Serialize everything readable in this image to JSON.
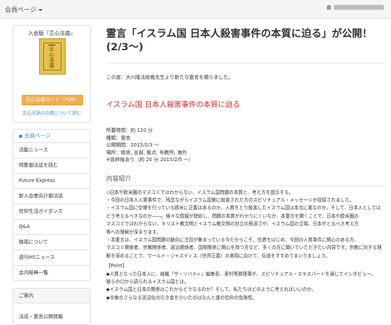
{
  "topbar": {
    "menu_label": "会員ページ"
  },
  "sidebar": {
    "book_panel_title": "入会版『正心法語』",
    "book_cover_text": "正心法語",
    "guide_button": "正心法語ガイド（PDF）",
    "guide_link": "正心法語の功徳について読む",
    "nav_head": "会員ページ",
    "nav_items": [
      "活動ニュース",
      "特集御法話を読む",
      "Future Express",
      "新入会者向け御法話",
      "信仰生活ガイダンス",
      "Q&A",
      "植福について",
      "週刊HSニュース",
      "会内経典一覧"
    ],
    "nav2_head": "ご案内",
    "nav2_items": [
      "法話・霊言公開情報"
    ]
  },
  "main": {
    "title": "霊言「イスラム国 日本人殺害事件の本質に迫る」が公開！(2/3〜)",
    "intro": "この度、大川隆法総裁先生より新たな霊言を賜りました。",
    "red_title": "イスラム国 日本人殺害事件の本質に迫る",
    "meta": [
      "所要時間：約 120 分",
      "種類：霊言",
      "公開期間：2015/2/3 〜",
      "場所：精舎, 支部, 拠点, 布教所, 海外",
      "※抜粋版あり（約 20 分 2015/2/5 〜）"
    ],
    "section_title": "内容紹介",
    "desc": [
      "◇日本や欧米圏のマスコミではわからない、イスラム国問題の本質と、考え方を提示する。",
      "・今回の日本人人質事件で、残念ながらイスラム国側に殺害された方のスピリチュアル・メッセージが収録されました。",
      "・イスラム国に空爆を行っている欧米に正義はあるのか。人質をとり殺害したイスラム国は本当に悪なのか。そして、日本人としては",
      "どう考えるべきなのか――。様々な情報が錯綜し、問題の本質がわかりにくいなか、本霊言を聞くことで、日本や欧米圏の",
      "マスコミではわからない、キリスト教文明とイスラム教文明の対立の根深さや、イスラム国の立場、日本がとるべき考え方",
      "等への理解が深まります。",
      "・本霊言は、イスラム国問題の動向に注目が集まっている今だからこそ、信者をはじめ、今回の人質事件に関心のある方、",
      "マスコミ関係者、宗教関係者、政治関係者、国際関係に関心を持つ方など、多くの方に聞いていただきたい内容です。宗教に対する理",
      "解を深めることで、ワールド・ジャスティス（世界正義）の実現に向けて、伝道をすすめてまいりましょう。"
    ],
    "point_head": "【Point】",
    "points": [
      "◆人質となった日本人に、綾織『ザ・リバティ』編集長、里村専務理事が、スピリチュアル・エキスパートを通じてインタビュー。",
      "彼らの口から語られるイスラム国とは。",
      "◆イスラム国と日本の関係はこれからどうなるのか？そして、私たちはどのように考えればいいのか。",
      "◆中東のさらなる泥沼化の引き金をひいたのはなんと誰の信仰の危険性。"
    ]
  }
}
